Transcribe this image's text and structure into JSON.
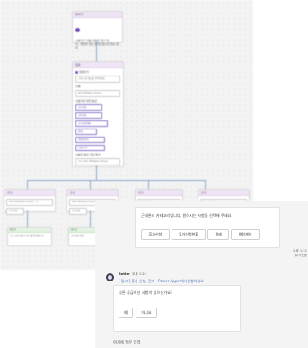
{
  "flow": {
    "trigger_card_title": "트리거",
    "trigger_card_text_1": "사용자가 다음 구문을 말할 때",
    "trigger_card_text_2": "다.. 방법이 있는 알려드립니다 있는 양지",
    "question_card_title": "질문",
    "question_label": "질문하기",
    "question_field": "근태 신청 메뉴를 선택하세요",
    "identify_label": "식별",
    "identify_value": "옵션 (Multiple choice)",
    "options_label": "사용자에 대한 옵션",
    "options": [
      "휴가신청",
      "휴직신청",
      "휴가신청현황",
      "결재",
      "병원계약서",
      "근태 관리"
    ],
    "save_response_label": "사용자 응답 저장 위치",
    "save_response_value": "{x} Var1 (Multiple choice)",
    "branch_labels": [
      "조건",
      "조건",
      "조건",
      "조건"
    ],
    "branch_values": [
      "Var1 (Multiple choice) · 다",
      "Var1 (Multiple choice) · 다",
      "Var1 (Multiple choice) · 다",
      "Var1 (Multiple choice) · 다"
    ],
    "branch_field": "휴가신청",
    "sub_label_1": "메시지",
    "sub_text_1": "휴가 신청 페이지 링크를 안내합니다",
    "sub_label_2": "메시지",
    "sub_text_2": "휴가신청 결재"
  },
  "chat": {
    "bot_prompt": "근태관리 카테고리입니다. 원하시는 사항을 선택해 주세요",
    "choice_buttons": [
      "휴가신청",
      "휴가신청현황",
      "결재",
      "병원계약"
    ],
    "user_time": "오후 1:21",
    "user_message": "휴가신청",
    "bot_name": "Botter",
    "bot_time": "오후 1:21",
    "bot_link": "[ 링크 ] 휴가 신청, 관리 - Power Apps(에서신청하세요",
    "followup_question": "다른 궁금하신 사항이 있으신가요?",
    "yes_no_buttons": [
      "예",
      "아니요"
    ],
    "input_placeholder": "여기에 질문 입력"
  },
  "colors": {
    "accent": "#6b4bb8",
    "connector": "#8aa7cc",
    "panel_bg": "#f4f4f4"
  }
}
